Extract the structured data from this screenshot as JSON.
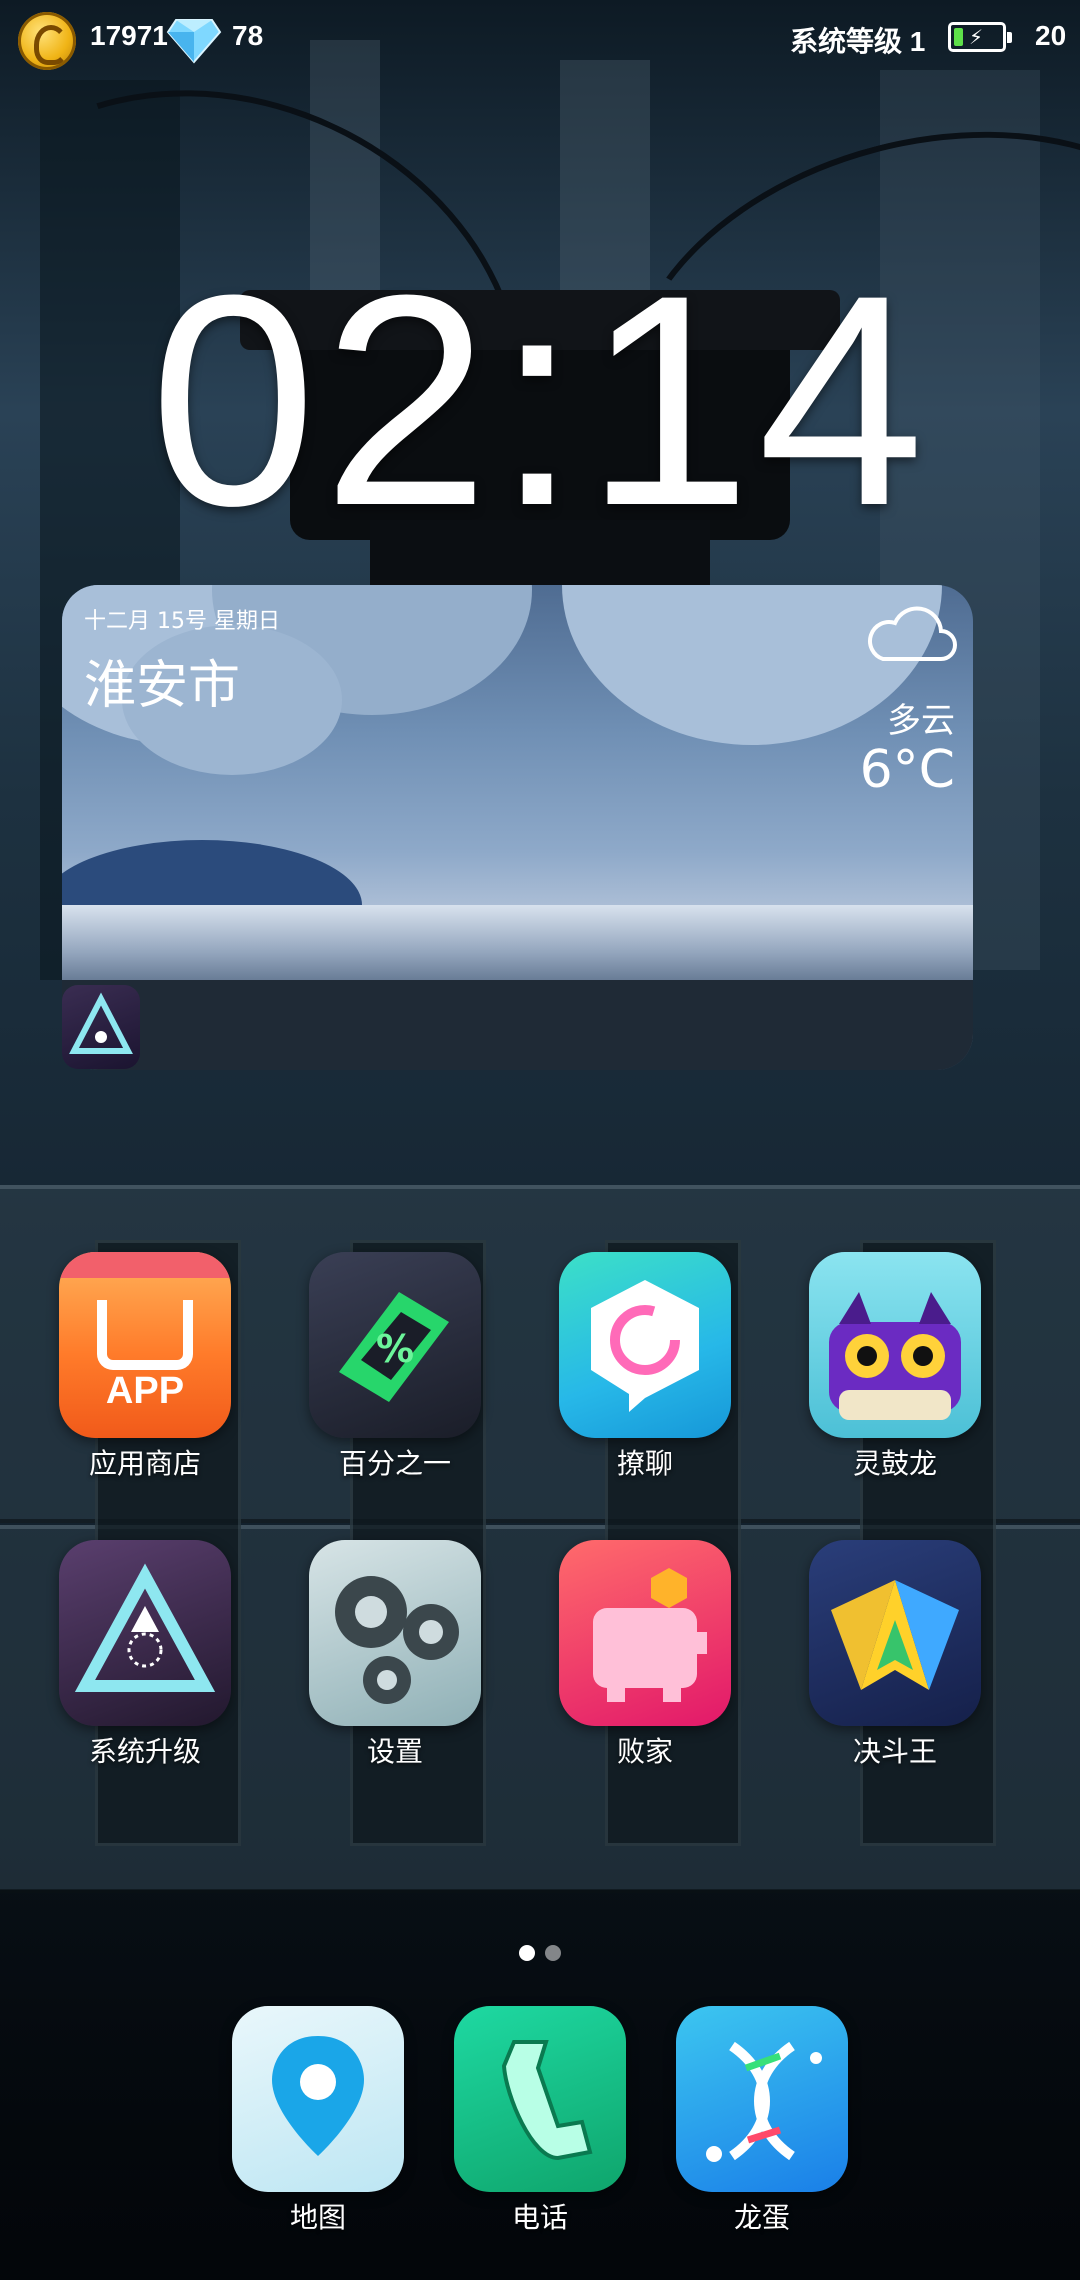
{
  "status_bar": {
    "coins": "17971",
    "gems": "78",
    "system_level": "系统等级 1",
    "battery_level": "20",
    "battery_fill_fraction": 0.2,
    "battery_color": "#5ee04a"
  },
  "clock": {
    "time": "02:14"
  },
  "weather": {
    "date": "十二月 15号 星期日",
    "city": "淮安市",
    "condition": "多云",
    "temperature": "6°C",
    "icon": "cloud-icon"
  },
  "apps_row1": [
    {
      "label": "应用商店",
      "icon": "app-store-icon",
      "badge_text": "APP"
    },
    {
      "label": "百分之一",
      "icon": "percent-icon"
    },
    {
      "label": "撩聊",
      "icon": "chat-icon"
    },
    {
      "label": "灵鼓龙",
      "icon": "dragon-icon"
    }
  ],
  "apps_row2": [
    {
      "label": "系统升级",
      "icon": "system-upgrade-icon"
    },
    {
      "label": "设置",
      "icon": "settings-gear-icon"
    },
    {
      "label": "败家",
      "icon": "piggy-bank-icon"
    },
    {
      "label": "决斗王",
      "icon": "duel-king-icon"
    }
  ],
  "page_indicator": {
    "pages": 2,
    "current": 1
  },
  "dock": [
    {
      "label": "地图",
      "icon": "map-pin-icon"
    },
    {
      "label": "电话",
      "icon": "phone-icon"
    },
    {
      "label": "龙蛋",
      "icon": "dna-egg-icon"
    }
  ]
}
